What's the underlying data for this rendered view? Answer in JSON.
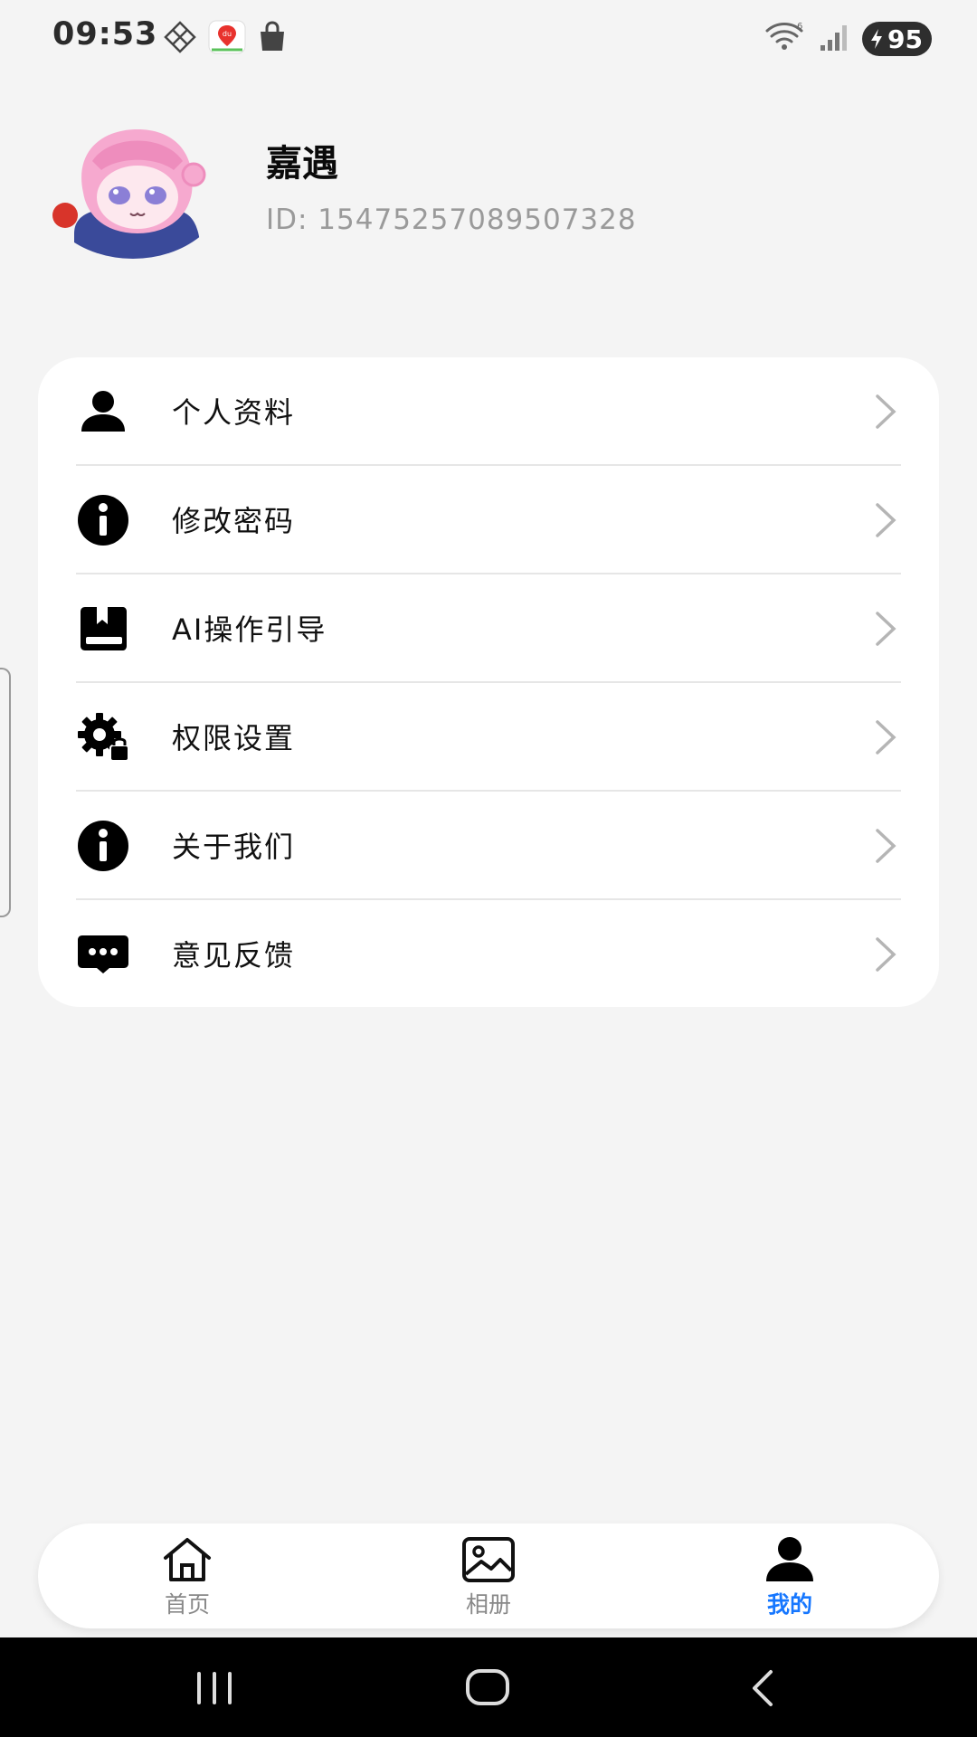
{
  "status_bar": {
    "time": "09:53",
    "left_icons": [
      "grid-diamond-icon",
      "baidu-map-icon",
      "shopping-bag-icon"
    ],
    "right_icons": [
      "wifi-6-icon",
      "cellular-signal-icon",
      "battery-charging-icon"
    ],
    "battery_level": "95"
  },
  "profile": {
    "name": "嘉遇",
    "id_text": "ID: 1547525708950732​8",
    "avatar": "anime-avatar"
  },
  "menu": {
    "items": [
      {
        "label": "个人资料",
        "icon": "person-icon"
      },
      {
        "label": "修改密码",
        "icon": "info-icon"
      },
      {
        "label": "AI操作引导",
        "icon": "book-icon"
      },
      {
        "label": "权限设置",
        "icon": "gear-lock-icon"
      },
      {
        "label": "关于我们",
        "icon": "info-icon"
      },
      {
        "label": "意见反馈",
        "icon": "chat-bubble-icon"
      }
    ]
  },
  "tabs": [
    {
      "label": "首页",
      "icon": "home-icon",
      "active": false
    },
    {
      "label": "相册",
      "icon": "image-icon",
      "active": false
    },
    {
      "label": "我的",
      "icon": "person-icon",
      "active": true
    }
  ],
  "colors": {
    "accent": "#1677ff",
    "background": "#f4f4f4",
    "card": "#ffffff"
  },
  "system_nav": [
    "recent-apps-icon",
    "home-button-icon",
    "back-icon"
  ]
}
